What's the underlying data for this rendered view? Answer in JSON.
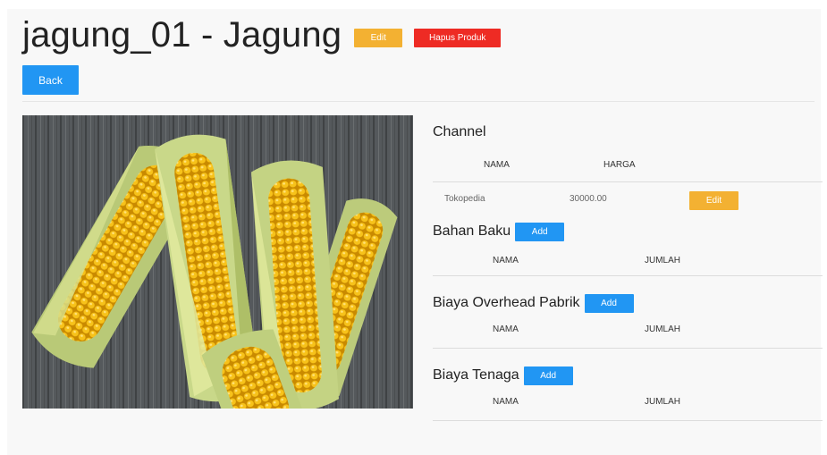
{
  "header": {
    "title": "jagung_01 - Jagung",
    "edit_label": "Edit",
    "delete_label": "Hapus Produk",
    "back_label": "Back"
  },
  "channel": {
    "title": "Channel",
    "columns": [
      "NAMA",
      "HARGA"
    ],
    "rows": [
      {
        "nama": "Tokopedia",
        "harga": "30000.00",
        "edit_label": "Edit"
      }
    ]
  },
  "bahan_baku": {
    "title": "Bahan Baku",
    "add_label": "Add",
    "columns": [
      "NAMA",
      "JUMLAH"
    ]
  },
  "overhead": {
    "title": "Biaya Overhead Pabrik",
    "add_label": "Add",
    "columns": [
      "NAMA",
      "JUMLAH"
    ]
  },
  "tenaga": {
    "title": "Biaya Tenaga",
    "add_label": "Add",
    "columns": [
      "NAMA",
      "JUMLAH"
    ]
  },
  "colors": {
    "primary": "#2196f3",
    "warning": "#f3b132",
    "danger": "#ee2b24"
  }
}
